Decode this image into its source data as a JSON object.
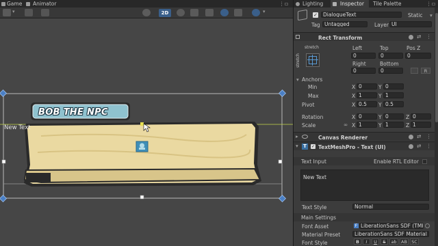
{
  "scene_tabs": {
    "game": "Game",
    "animator": "Animator"
  },
  "scene_toolbar": {
    "mode_2d": "2D"
  },
  "scene": {
    "npc_name": "BOB THE NPC",
    "overlay_label": "New Text"
  },
  "inspector_tabs": {
    "lighting": "Lighting",
    "inspector": "Inspector",
    "tile_palette": "Tile Palette"
  },
  "object": {
    "name": "DialogueText",
    "static_label": "Static",
    "tag_label": "Tag",
    "tag_value": "Untagged",
    "layer_label": "Layer",
    "layer_value": "UI"
  },
  "rect_transform": {
    "title": "Rect Transform",
    "anchor_preset_top": "stretch",
    "anchor_preset_side": "stretch",
    "headers": {
      "left": "Left",
      "top": "Top",
      "posz": "Pos Z",
      "right": "Right",
      "bottom": "Bottom"
    },
    "values": {
      "left": "0",
      "top": "0",
      "posz": "0",
      "right": "0",
      "bottom": "0"
    },
    "r_button": "R",
    "anchors_label": "Anchors",
    "min_label": "Min",
    "min_x": "0",
    "min_y": "0",
    "max_label": "Max",
    "max_x": "1",
    "max_y": "1",
    "pivot_label": "Pivot",
    "pivot_x": "0.5",
    "pivot_y": "0.5",
    "rotation_label": "Rotation",
    "rot_x": "0",
    "rot_y": "0",
    "rot_z": "0",
    "scale_label": "Scale",
    "scale_x": "1",
    "scale_y": "1",
    "scale_z": "1",
    "axis_x": "X",
    "axis_y": "Y",
    "axis_z": "Z"
  },
  "canvas_renderer": {
    "title": "Canvas Renderer"
  },
  "tmp": {
    "title": "TextMeshPro - Text (UI)",
    "text_input_label": "Text Input",
    "enable_rtl": "Enable RTL Editor",
    "text_value": "New Text",
    "text_style_label": "Text Style",
    "text_style_value": "Normal",
    "main_settings": "Main Settings",
    "font_asset_label": "Font Asset",
    "font_asset_value": "LiberationSans SDF (TMP_)",
    "material_preset_label": "Material Preset",
    "material_preset_value": "LiberationSans SDF Material",
    "font_style_label": "Font Style",
    "font_style_buttons": [
      "B",
      "I",
      "U",
      "S",
      "ab",
      "AB",
      "SC"
    ]
  },
  "colors": {
    "accent_blue": "#3a5f8a",
    "panel": "#3c3c3c",
    "scene_bg": "#464646",
    "dialogue_box": "#eadca0",
    "name_plate": "#8fc2cf"
  }
}
